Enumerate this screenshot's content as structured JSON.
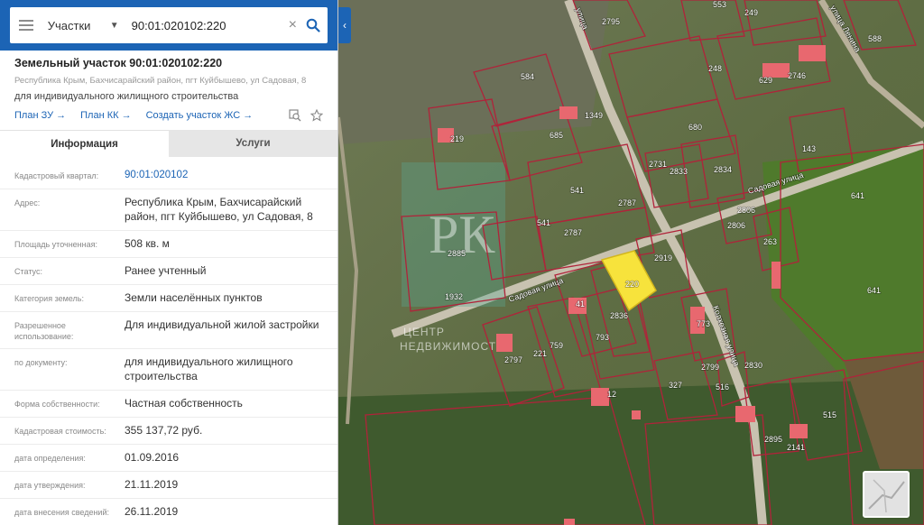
{
  "search": {
    "type_label": "Участки",
    "query": "90:01:020102:220"
  },
  "parcel": {
    "title": "Земельный участок 90:01:020102:220",
    "address": "Республика Крым, Бахчисарайский район, пгт Куйбышево, ул Садовая, 8",
    "purpose": "для индивидуального жилищного строительства"
  },
  "links": {
    "plan_zu": "План ЗУ →",
    "plan_kk": "План КК →",
    "create_zs": "Создать участок ЖС →"
  },
  "tabs": {
    "info": "Информация",
    "services": "Услуги"
  },
  "fields": [
    {
      "label": "Кадастровый квартал:",
      "value": "90:01:020102"
    },
    {
      "label": "Адрес:",
      "value": "Республика Крым, Бахчисарайский район, пгт Куйбышево, ул Садовая, 8"
    },
    {
      "label": "Площадь уточненная:",
      "value": "508 кв. м"
    },
    {
      "label": "Статус:",
      "value": "Ранее учтенный"
    },
    {
      "label": "Категория земель:",
      "value": "Земли населённых пунктов"
    },
    {
      "label": "Разрешенное использование:",
      "value": "Для индивидуальной жилой застройки"
    },
    {
      "label": "по документу:",
      "value": "для индивидуального жилищного строительства"
    },
    {
      "label": "Форма собственности:",
      "value": "Частная собственность"
    },
    {
      "label": "Кадастровая стоимость:",
      "value": "355 137,72 руб."
    },
    {
      "label": "дата определения:",
      "value": "01.09.2016"
    },
    {
      "label": "дата утверждения:",
      "value": "21.11.2019"
    },
    {
      "label": "дата внесения сведений:",
      "value": "26.11.2019"
    }
  ],
  "map": {
    "streets": {
      "sadovaya_left": "Садовая улица",
      "sadovaya_right": "Садовая улица",
      "kolkhoznaya": "Колхозная улица",
      "top_street": "улица",
      "top_right_street": "улица Ленина"
    },
    "parcel_numbers": [
      "2795",
      "553",
      "249",
      "588",
      "584",
      "248",
      "629",
      "2746",
      "1349",
      "219",
      "685",
      "680",
      "143",
      "2731",
      "2833",
      "2834",
      "541",
      "2787",
      "541",
      "2806",
      "2806",
      "2787",
      "263",
      "641",
      "2885",
      "2919",
      "220",
      "2836",
      "41",
      "793",
      "773",
      "641",
      "2797",
      "221",
      "759",
      "2799",
      "327",
      "516",
      "12",
      "2895",
      "2141",
      "515",
      "1932",
      "2830"
    ],
    "watermark": {
      "letters": "РК",
      "line1": "ЦЕНТР",
      "line2": "НЕДВИЖИМОСТИ"
    },
    "colors": {
      "boundary": "#b0233a",
      "selected_fill": "#f7e33c",
      "building": "#e8686f"
    }
  },
  "colors": {
    "accent": "#1c64b5",
    "tab_inactive_bg": "#e6e6e6"
  }
}
